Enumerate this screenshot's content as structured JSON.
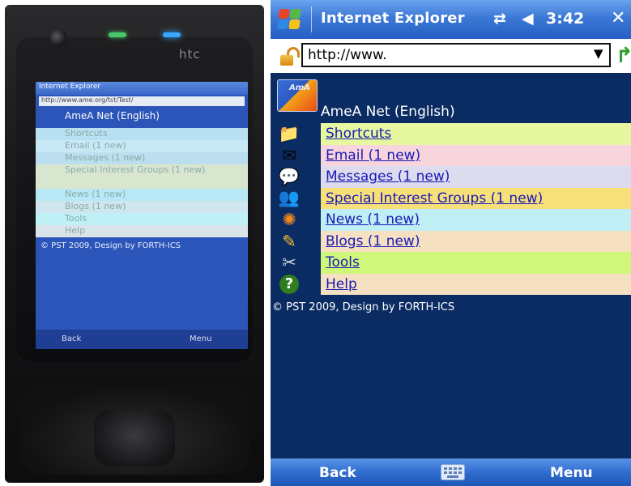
{
  "photo": {
    "brand": "htc",
    "mini_screen": {
      "title_bar": "Internet Explorer",
      "address": "http://www.ame.org/tst/Test/",
      "site_title": "AmeA Net (English)",
      "rows": [
        "Shortcuts",
        "Email (1 new)",
        "Messages (1 new)",
        "Special Interest Groups (1 new)",
        "News (1 new)",
        "Blogs (1 new)",
        "Tools",
        "Help"
      ],
      "footer": "© PST 2009, Design by FORTH-ICS",
      "softkey_left": "Back",
      "softkey_right": "Menu"
    }
  },
  "titlebar": {
    "app_title": "Internet Explorer",
    "time": "3:42",
    "connectivity_icon": "connectivity-icon",
    "volume_icon": "volume-icon",
    "close_label": "✕"
  },
  "addressbar": {
    "url": "http://www.",
    "dropdown_glyph": "▼",
    "go_glyph": "↱"
  },
  "site": {
    "logo_text": "AmA",
    "title": "AmeA Net (English)",
    "menu": [
      {
        "label": "Shortcuts",
        "icon": "shortcuts-icon",
        "bg": "#e6f7a0"
      },
      {
        "label": "Email (1 new)",
        "icon": "email-icon",
        "bg": "#f8d5dd"
      },
      {
        "label": "Messages (1 new)",
        "icon": "messages-icon",
        "bg": "#dcdcee"
      },
      {
        "label": "Special Interest Groups (1 new)",
        "icon": "groups-icon",
        "bg": "#f7e07a"
      },
      {
        "label": "News (1 new)",
        "icon": "news-icon",
        "bg": "#bfeff4"
      },
      {
        "label": "Blogs (1 new)",
        "icon": "blogs-icon",
        "bg": "#f5e1c1"
      },
      {
        "label": "Tools",
        "icon": "tools-icon",
        "bg": "#cff77a"
      },
      {
        "label": "Help",
        "icon": "help-icon",
        "bg": "#f5e1c1"
      }
    ],
    "footer": "© PST 2009, Design by FORTH-ICS"
  },
  "softkeys": {
    "left": "Back",
    "right": "Menu",
    "center_icon": "keyboard-icon"
  }
}
